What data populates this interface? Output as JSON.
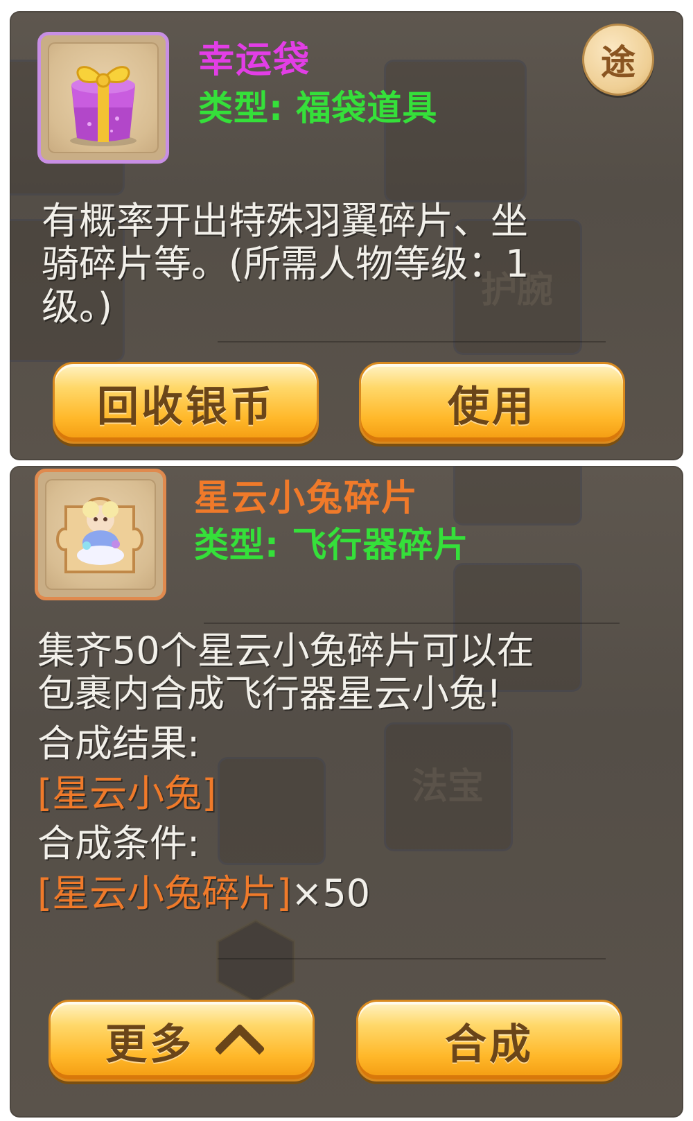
{
  "top_panel": {
    "item_name": "幸运袋",
    "item_type": "类型: 福袋道具",
    "source_button": "途",
    "description": [
      "有概率开出特殊羽翼碎片、坐",
      "骑碎片等。(所需人物等级：1",
      "级。)"
    ],
    "buttons": {
      "recycle": "回收银币",
      "use": "使用"
    },
    "icon": "gift-box-icon",
    "colors": {
      "name": "#e23ee6",
      "type": "#35e03a"
    }
  },
  "bottom_panel": {
    "item_name": "星云小兔碎片",
    "item_type": "类型: 飞行器碎片",
    "description": [
      "集齐50个星云小兔碎片可以在",
      "包裹内合成飞行器星云小兔!"
    ],
    "result_label": "合成结果:",
    "result_item": "[星云小兔]",
    "condition_label": "合成条件:",
    "condition_item": "[星云小兔碎片]",
    "condition_count": "×50",
    "buttons": {
      "more": "更多",
      "compose": "合成"
    },
    "icon": "puzzle-piece-icon",
    "colors": {
      "name": "#f07a2a",
      "type": "#35e03a"
    }
  }
}
